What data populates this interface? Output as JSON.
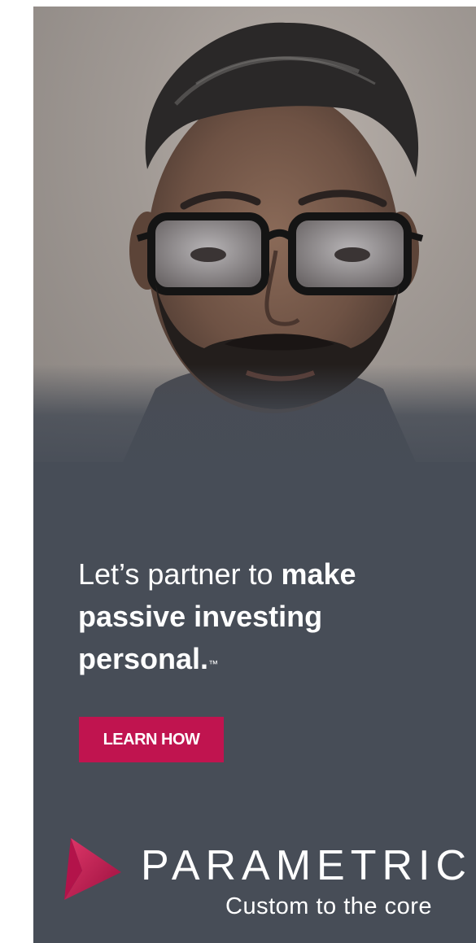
{
  "ad": {
    "headline": {
      "light": "Let’s partner to ",
      "bold_1": "make",
      "bold_2": "passive investing",
      "bold_3": "personal.",
      "trademark": "™"
    },
    "cta_label": "LEARN HOW",
    "brand_name": "PARAMETRIC",
    "tagline": "Custom to the core",
    "colors": {
      "panel": "#474d57",
      "cta": "#c0144f",
      "logo_mark": "#c0144f",
      "text": "#ffffff"
    },
    "icons": {
      "logo": "parametric-arrow-logo-icon"
    }
  }
}
